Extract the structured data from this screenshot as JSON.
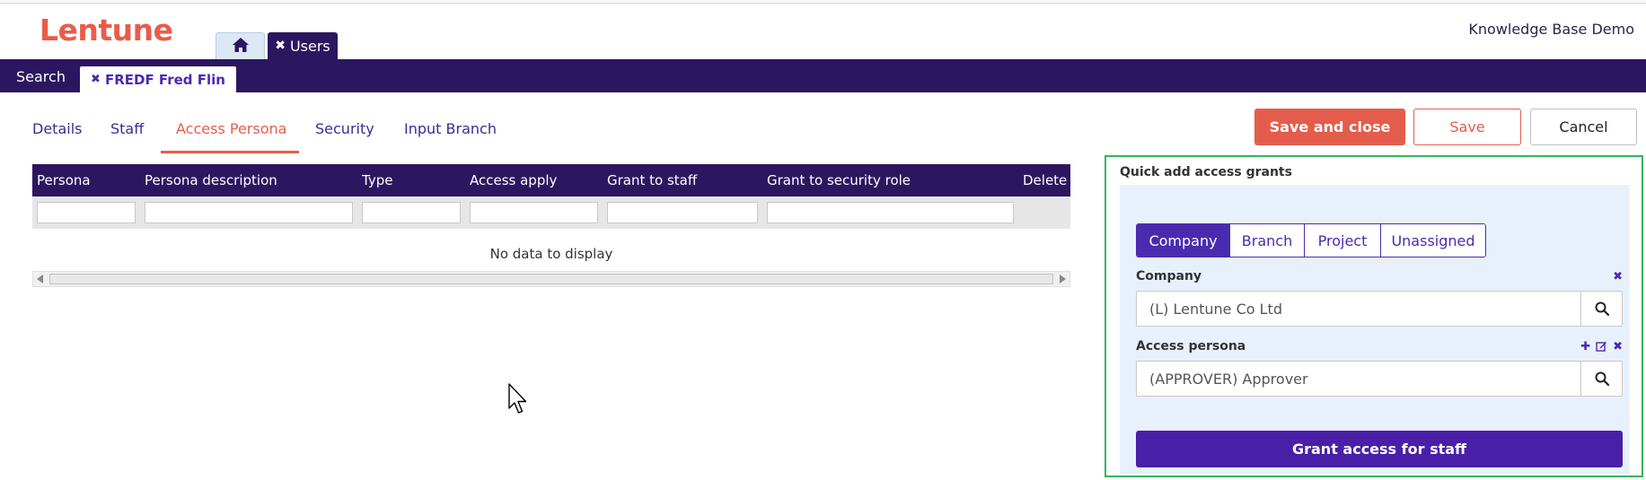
{
  "header": {
    "logo": "Lentune",
    "app_tabs": {
      "home_icon": "home-icon",
      "users_label": "Users",
      "users_close": "✖"
    },
    "workspace_title": "Knowledge Base Demo"
  },
  "navbar": {
    "search_label": "Search",
    "record_tab_label": "FREDF Fred Flin",
    "record_tab_close": "✖"
  },
  "subtabs": [
    {
      "label": "Details"
    },
    {
      "label": "Staff"
    },
    {
      "label": "Access Persona",
      "active": true
    },
    {
      "label": "Security"
    },
    {
      "label": "Input Branch"
    }
  ],
  "actions": {
    "save_close": "Save and close",
    "save": "Save",
    "cancel": "Cancel"
  },
  "grid": {
    "columns": [
      "Persona",
      "Persona description",
      "Type",
      "Access apply",
      "Grant to staff",
      "Grant to security role",
      "Delete"
    ],
    "empty_text": "No data to display"
  },
  "quick_add": {
    "title": "Quick add access grants",
    "scope_options": [
      "Company",
      "Branch",
      "Project",
      "Unassigned"
    ],
    "selected_scope": "Company",
    "company_label": "Company",
    "company_value": "(L) Lentune Co Ltd",
    "persona_label": "Access persona",
    "persona_value": "(APPROVER) Approver",
    "grant_button": "Grant access for staff"
  },
  "colors": {
    "brand": "#e85c4a",
    "navy": "#2b1760",
    "accent": "#4a2bb0",
    "panel_border": "#35b45a"
  }
}
